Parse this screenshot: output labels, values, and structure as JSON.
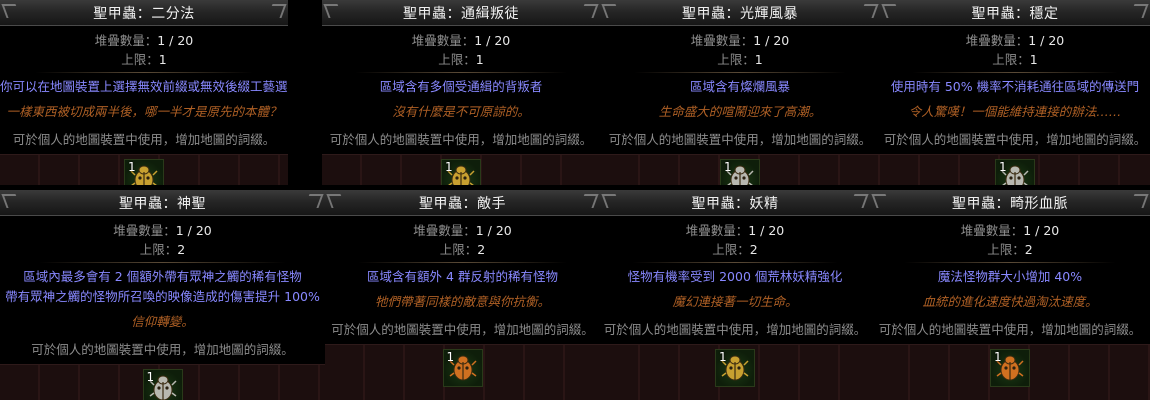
{
  "labels": {
    "stack_label": "堆疊數量：",
    "stack_value": "1 / 20",
    "limit_label": "上限：",
    "help_text": "可於個人的地圖裝置中使用，增加地圖的詞綴。"
  },
  "colors": {
    "scarab_gold": "#c8a030",
    "scarab_silver": "#b8b8b0",
    "scarab_orange": "#d07020"
  },
  "cards": [
    {
      "title": "聖甲蟲：二分法",
      "limit": "1",
      "mods": [
        "你可以在地圖裝置上選擇無效前綴或無效後綴工藝選項"
      ],
      "flavour": [
        "一樣東西被切成兩半後，哪一半才是原先的本體？"
      ],
      "slot_count": "1",
      "icon": "scarab-gold-icon"
    },
    {
      "title": "聖甲蟲：通緝叛徒",
      "limit": "1",
      "mods": [
        "區域含有多個受通緝的背叛者"
      ],
      "flavour": [
        "沒有什麼是不可原諒的。"
      ],
      "slot_count": "1",
      "icon": "scarab-gold-icon"
    },
    {
      "title": "聖甲蟲：光輝風暴",
      "limit": "1",
      "mods": [
        "區域含有燦爛風暴"
      ],
      "flavour": [
        "生命盛大的喧鬧迎來了高潮。"
      ],
      "slot_count": "1",
      "icon": "scarab-silver-icon"
    },
    {
      "title": "聖甲蟲：穩定",
      "limit": "1",
      "mods": [
        "使用時有 50% 機率不消耗通往區域的傳送門"
      ],
      "flavour": [
        "令人驚嘆！一個能維持連接的辦法……"
      ],
      "slot_count": "1",
      "icon": "scarab-silver-icon"
    },
    {
      "title": "聖甲蟲：神聖",
      "limit": "2",
      "mods": [
        "區域內最多會有 2 個額外帶有眾神之觸的稀有怪物",
        "帶有眾神之觸的怪物所召喚的映像造成的傷害提升 100%"
      ],
      "flavour": [
        "信仰轉變。"
      ],
      "slot_count": "1",
      "icon": "scarab-silver-icon"
    },
    {
      "title": "聖甲蟲：敵手",
      "limit": "2",
      "mods": [
        "區域含有額外 4 群反射的稀有怪物"
      ],
      "flavour": [
        "牠們帶著同樣的敵意與你抗衡。"
      ],
      "slot_count": "1",
      "icon": "scarab-orange-icon"
    },
    {
      "title": "聖甲蟲：妖精",
      "limit": "2",
      "mods": [
        "怪物有機率受到 2000 個荒林妖精強化"
      ],
      "flavour": [
        "魔幻連接著一切生命。"
      ],
      "slot_count": "1",
      "icon": "scarab-gold-icon"
    },
    {
      "title": "聖甲蟲：畸形血脈",
      "limit": "2",
      "mods": [
        "魔法怪物群大小增加 40%"
      ],
      "flavour": [
        "血統的進化速度快過淘汰速度。"
      ],
      "slot_count": "1",
      "icon": "scarab-orange-icon"
    }
  ]
}
